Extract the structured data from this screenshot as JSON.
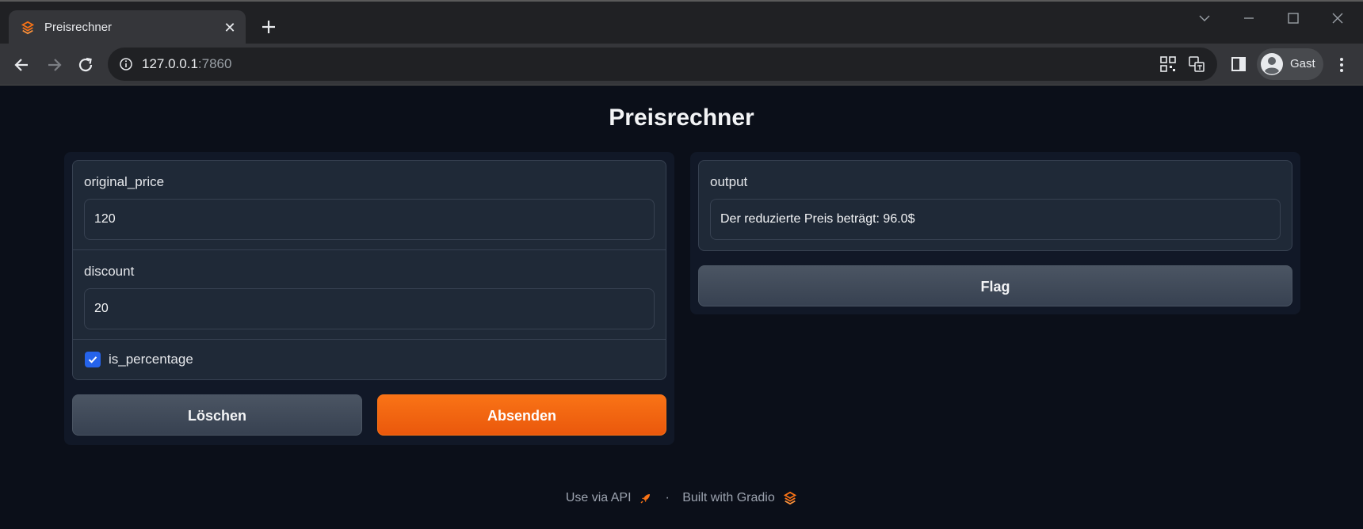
{
  "browser": {
    "tab_title": "Preisrechner",
    "close_glyph": "✕",
    "url_host": "127.0.0.1",
    "url_port": ":7860",
    "profile_name": "Gast"
  },
  "app": {
    "title": "Preisrechner",
    "inputs": {
      "original_price_label": "original_price",
      "original_price_value": "120",
      "discount_label": "discount",
      "discount_value": "20",
      "is_percentage_label": "is_percentage",
      "is_percentage_checked": true
    },
    "buttons": {
      "clear_label": "Löschen",
      "submit_label": "Absenden",
      "flag_label": "Flag"
    },
    "output": {
      "label": "output",
      "value": "Der reduzierte Preis beträgt: 96.0$"
    },
    "footer": {
      "api_label": "Use via API",
      "separator": "·",
      "built_with_label": "Built with Gradio"
    }
  },
  "colors": {
    "accent": "#f97316",
    "checkbox": "#2563eb",
    "background": "#0b0f19"
  },
  "icons": [
    "gradio-logo-icon",
    "close-icon",
    "plus-icon",
    "back-icon",
    "forward-icon",
    "reload-icon",
    "info-icon",
    "qr-icon",
    "translate-icon",
    "side-panel-icon",
    "avatar-icon",
    "more-vert-icon",
    "rocket-icon",
    "checkmark-icon"
  ]
}
